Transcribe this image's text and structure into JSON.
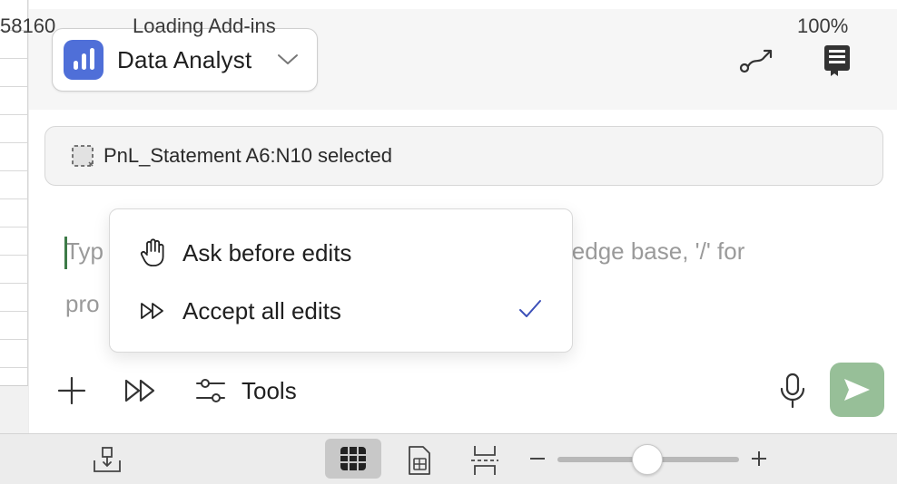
{
  "agent": {
    "name": "Data Analyst",
    "logo_color": "#4f6fd8"
  },
  "header_icons": [
    "route-icon",
    "book-icon"
  ],
  "selection": {
    "text": "PnL_Statement A6:N10 selected",
    "icon": "range-selection-icon"
  },
  "input": {
    "placeholder_start": "Typ",
    "placeholder_middle": "ledge base, '/' for",
    "placeholder_line2": "pro"
  },
  "edit_mode_menu": {
    "items": [
      {
        "label": "Ask before edits",
        "icon": "hand-icon",
        "selected": false
      },
      {
        "label": "Accept all edits",
        "icon": "fast-forward-icon",
        "selected": true
      }
    ],
    "check_color": "#3b4fb8"
  },
  "toolbar": {
    "tools_label": "Tools",
    "send_color": "#97bf98"
  },
  "statusbar": {
    "left_value": "58160",
    "addins_label": "Loading Add-ins",
    "zoom_percent": "100%",
    "zoom_level": 0.5
  }
}
